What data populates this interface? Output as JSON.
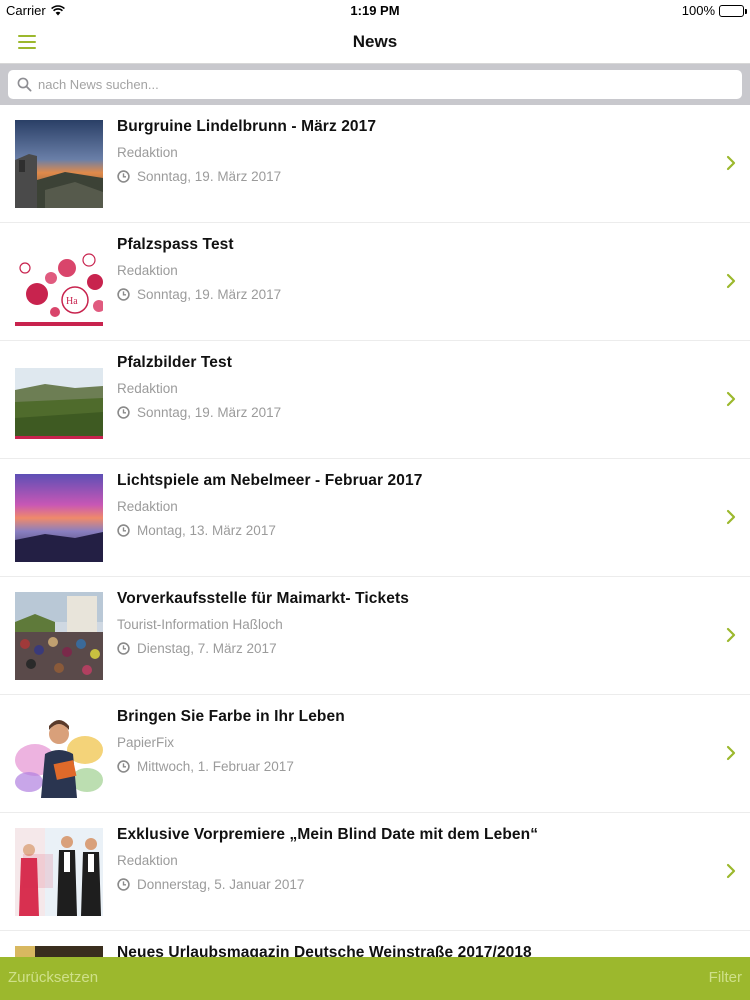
{
  "status_bar": {
    "carrier": "Carrier",
    "time": "1:19 PM",
    "battery": "100%"
  },
  "nav": {
    "title": "News",
    "menu_icon": "hamburger-menu-icon"
  },
  "search": {
    "placeholder": "nach News suchen...",
    "value": ""
  },
  "colors": {
    "accent": "#9cb82d",
    "secondary_text": "#9b9b9b",
    "search_background": "#c8c8cd"
  },
  "news": [
    {
      "title": "Burgruine Lindelbrunn - März 2017",
      "author": "Redaktion",
      "date": "Sonntag, 19. März 2017",
      "thumbnail": "castle-ruin-sunset-photo"
    },
    {
      "title": "Pfalzspass Test",
      "author": "Redaktion",
      "date": "Sonntag, 19. März 2017",
      "thumbnail": "speech-bubbles-graphic"
    },
    {
      "title": "Pfalzbilder Test",
      "author": "Redaktion",
      "date": "Sonntag, 19. März 2017",
      "thumbnail": "vineyard-landscape-photo"
    },
    {
      "title": "Lichtspiele am Nebelmeer - Februar 2017",
      "author": "Redaktion",
      "date": "Montag, 13. März 2017",
      "thumbnail": "sunset-fog-photo"
    },
    {
      "title": "Vorverkaufsstelle für Maimarkt- Tickets",
      "author": "Tourist-Information Haßloch",
      "date": "Dienstag, 7. März 2017",
      "thumbnail": "festival-crowd-photo"
    },
    {
      "title": "Bringen Sie Farbe in Ihr Leben",
      "author": "PapierFix",
      "date": "Mittwoch, 1. Februar 2017",
      "thumbnail": "colorful-man-photo"
    },
    {
      "title": "Exklusive Vorpremiere „Mein Blind Date mit dem Leben“",
      "author": "Redaktion",
      "date": "Donnerstag, 5. Januar 2017",
      "thumbnail": "movie-poster"
    },
    {
      "title": "Neues Urlaubsmagazin Deutsche Weinstraße 2017/2018",
      "author": "",
      "date": "",
      "thumbnail": "magazine-cover"
    }
  ],
  "bottom_bar": {
    "reset_label": "Zurücksetzen",
    "filter_label": "Filter"
  }
}
